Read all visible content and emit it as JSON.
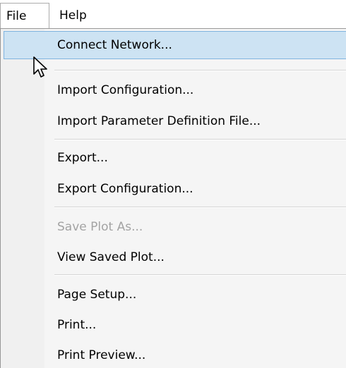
{
  "menubar": {
    "file_label": "File",
    "help_label": "Help"
  },
  "menu": {
    "connect_network": "Connect Network...",
    "import_configuration": "Import Configuration...",
    "import_parameter_definition_file": "Import Parameter Definition File...",
    "export": "Export...",
    "export_configuration": "Export Configuration...",
    "save_plot_as": "Save Plot As...",
    "view_saved_plot": "View Saved Plot...",
    "page_setup": "Page Setup...",
    "print": "Print...",
    "print_preview": "Print Preview..."
  },
  "state": {
    "highlighted_item": "Connect Network...",
    "disabled_items": [
      "Save Plot As..."
    ]
  },
  "colors": {
    "highlight_bg": "#cde3f3",
    "highlight_border": "#7fb3df",
    "disabled_text": "#a3a3a3"
  },
  "icons": {
    "pointer": "mouse-pointer-icon"
  }
}
